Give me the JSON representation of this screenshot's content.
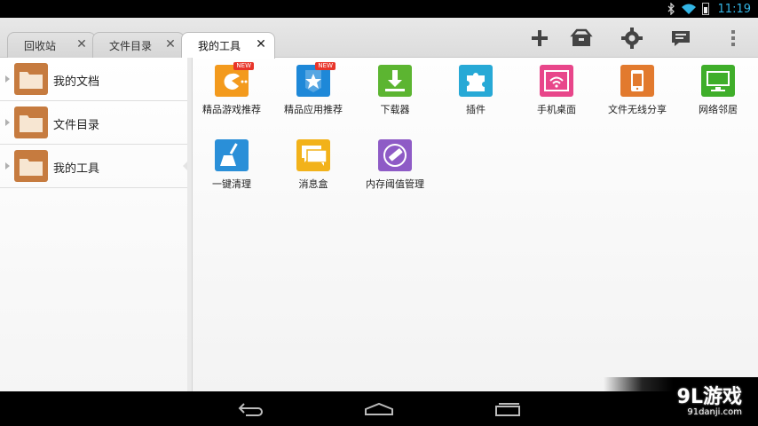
{
  "status_bar": {
    "time": "11:19",
    "icons": [
      "bluetooth-icon",
      "wifi-icon",
      "battery-icon"
    ],
    "accent_color": "#33b5e5"
  },
  "tabs": [
    {
      "label": "回收站",
      "active": false
    },
    {
      "label": "文件目录",
      "active": false
    },
    {
      "label": "我的工具",
      "active": true
    }
  ],
  "tab_close_glyph": "✕",
  "toolbar_actions": [
    "add-icon",
    "toolbox-icon",
    "settings-icon",
    "message-icon",
    "overflow-menu-icon"
  ],
  "sidebar": {
    "items": [
      {
        "label": "我的文档",
        "icon": "folder-icon"
      },
      {
        "label": "文件目录",
        "icon": "folder-icon"
      },
      {
        "label": "我的工具",
        "icon": "folder-icon",
        "selected": true
      }
    ]
  },
  "tools": {
    "new_badge": "NEW",
    "items": [
      {
        "label": "精品游戏推荐",
        "icon": "game-icon",
        "color": "#f39a1d",
        "badge": true
      },
      {
        "label": "精品应用推荐",
        "icon": "app-store-icon",
        "color": "#1e88d8",
        "badge": true
      },
      {
        "label": "下载器",
        "icon": "download-icon",
        "color": "#5cb531"
      },
      {
        "label": "插件",
        "icon": "plugin-icon",
        "color": "#27a9d6"
      },
      {
        "label": "手机桌面",
        "icon": "wifi-desktop-icon",
        "color": "#e8468a"
      },
      {
        "label": "文件无线分享",
        "icon": "phone-share-icon",
        "color": "#e27a2e"
      },
      {
        "label": "网络邻居",
        "icon": "monitor-icon",
        "color": "#3fae2a"
      },
      {
        "label": "一键清理",
        "icon": "broom-icon",
        "color": "#2a8fd8"
      },
      {
        "label": "消息盒",
        "icon": "message-box-icon",
        "color": "#f2b21a"
      },
      {
        "label": "内存阈值管理",
        "icon": "memory-icon",
        "color": "#8e5bc6"
      }
    ]
  },
  "nav_bar": [
    "back-icon",
    "home-icon",
    "recents-icon"
  ],
  "watermark": {
    "logo": "9L游戏",
    "url": "91danji.com"
  }
}
